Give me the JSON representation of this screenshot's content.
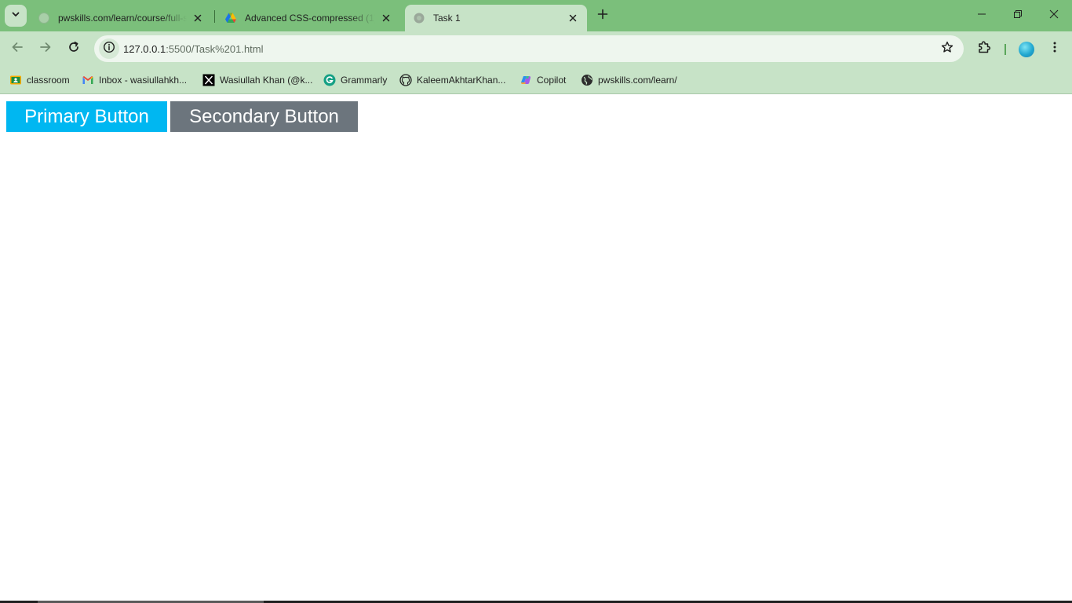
{
  "browser": {
    "tabs": [
      {
        "title": "pwskills.com/learn/course/full-s",
        "favicon": "globe-gray-icon",
        "active": false
      },
      {
        "title": "Advanced CSS-compressed (1).p",
        "favicon": "google-drive-icon",
        "active": false
      },
      {
        "title": "Task 1",
        "favicon": "globe-gray-icon",
        "active": true
      }
    ],
    "address_bar": {
      "url_host": "127.0.0.1",
      "url_rest": ":5500/Task%201.html"
    },
    "bookmarks": [
      {
        "label": "classroom",
        "icon": "google-classroom-icon"
      },
      {
        "label": "Inbox - wasiullahkh...",
        "icon": "gmail-icon"
      },
      {
        "label": "Wasiullah Khan (@k...",
        "icon": "x-icon"
      },
      {
        "label": "Grammarly",
        "icon": "grammarly-icon"
      },
      {
        "label": "KaleemAkhtarKhan...",
        "icon": "github-icon"
      },
      {
        "label": "Copilot",
        "icon": "copilot-icon"
      },
      {
        "label": "pwskills.com/learn/",
        "icon": "globe-icon"
      }
    ],
    "colors": {
      "frame": "#7bbf7b",
      "toolbar": "#c7e3c7"
    }
  },
  "page": {
    "primary_button": {
      "label": "Primary Button",
      "color": "#00b7f1"
    },
    "secondary_button": {
      "label": "Secondary Button",
      "color": "#6c757d"
    }
  }
}
